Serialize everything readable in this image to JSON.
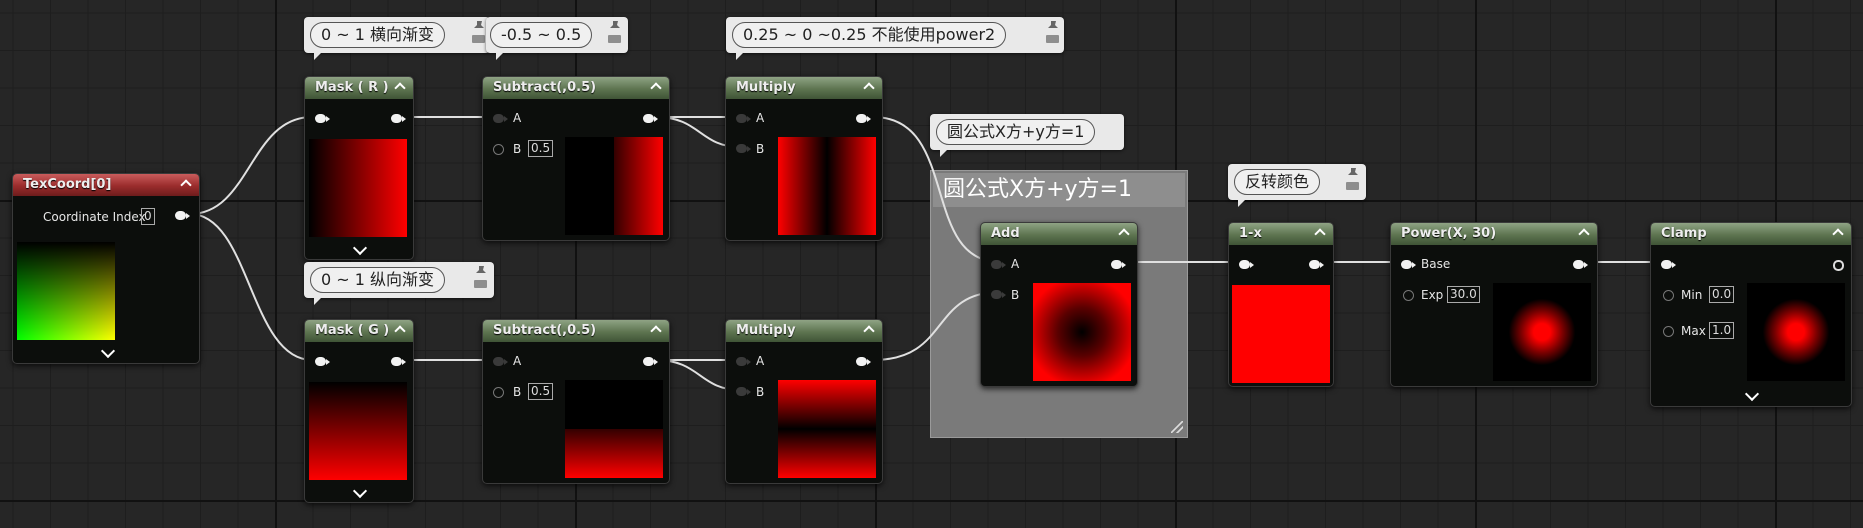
{
  "comment_box": {
    "title": "圆公式X方+y方=1"
  },
  "bubbles": {
    "mask_r": "0 ~ 1 横向渐变",
    "subtract_r": "-0.5 ~ 0.5",
    "multiply_r": "0.25 ~ 0 ~0.25 不能使用power2",
    "mask_g": "0 ~ 1 纵向渐变",
    "add": "圆公式X方+y方=1",
    "one_minus": "反转颜色"
  },
  "nodes": {
    "texcoord": {
      "title": "TexCoord[0]",
      "coord_label": "Coordinate Index",
      "coord_value": "0"
    },
    "mask_r": {
      "title": "Mask ( R )"
    },
    "mask_g": {
      "title": "Mask ( G )"
    },
    "subtract_r": {
      "title": "Subtract(,0.5)",
      "a": "A",
      "b": "B",
      "b_value": "0.5"
    },
    "subtract_g": {
      "title": "Subtract(,0.5)",
      "a": "A",
      "b": "B",
      "b_value": "0.5"
    },
    "multiply_r": {
      "title": "Multiply",
      "a": "A",
      "b": "B"
    },
    "multiply_g": {
      "title": "Multiply",
      "a": "A",
      "b": "B"
    },
    "add": {
      "title": "Add",
      "a": "A",
      "b": "B"
    },
    "one_minus": {
      "title": "1-x"
    },
    "power": {
      "title": "Power(X, 30)",
      "base": "Base",
      "exp": "Exp",
      "exp_value": "30.0"
    },
    "clamp": {
      "title": "Clamp",
      "min": "Min",
      "min_value": "0.0",
      "max": "Max",
      "max_value": "1.0"
    }
  },
  "colors": {
    "node_header": "#5d7450",
    "texcoord_header": "#9a2c2c",
    "wire": "#e6e6e6",
    "comment": "#7a7a7a"
  }
}
